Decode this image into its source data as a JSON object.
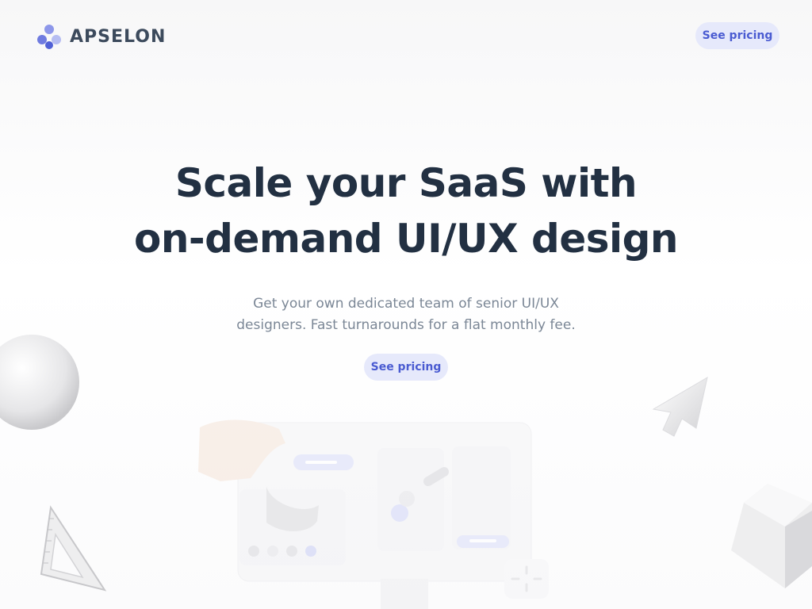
{
  "header": {
    "brand": "APSELON",
    "pricing_button": "See pricing"
  },
  "hero": {
    "title_line1": "Scale your SaaS with",
    "title_line2": "on-demand UI/UX design",
    "subtitle_line1": "Get your own dedicated team of senior UI/UX",
    "subtitle_line2": "designers. Fast turnarounds for a flat monthly fee.",
    "cta_button": "See pricing"
  },
  "colors": {
    "accent": "#4a5bd1",
    "button_bg": "#e6e9fb",
    "heading": "#223042",
    "body_text": "#7b8796"
  },
  "icons": [
    "logo-mark-icon",
    "sphere-icon",
    "cursor-arrow-icon",
    "triangle-ruler-icon",
    "cube-icon",
    "design-tablet-illustration"
  ]
}
